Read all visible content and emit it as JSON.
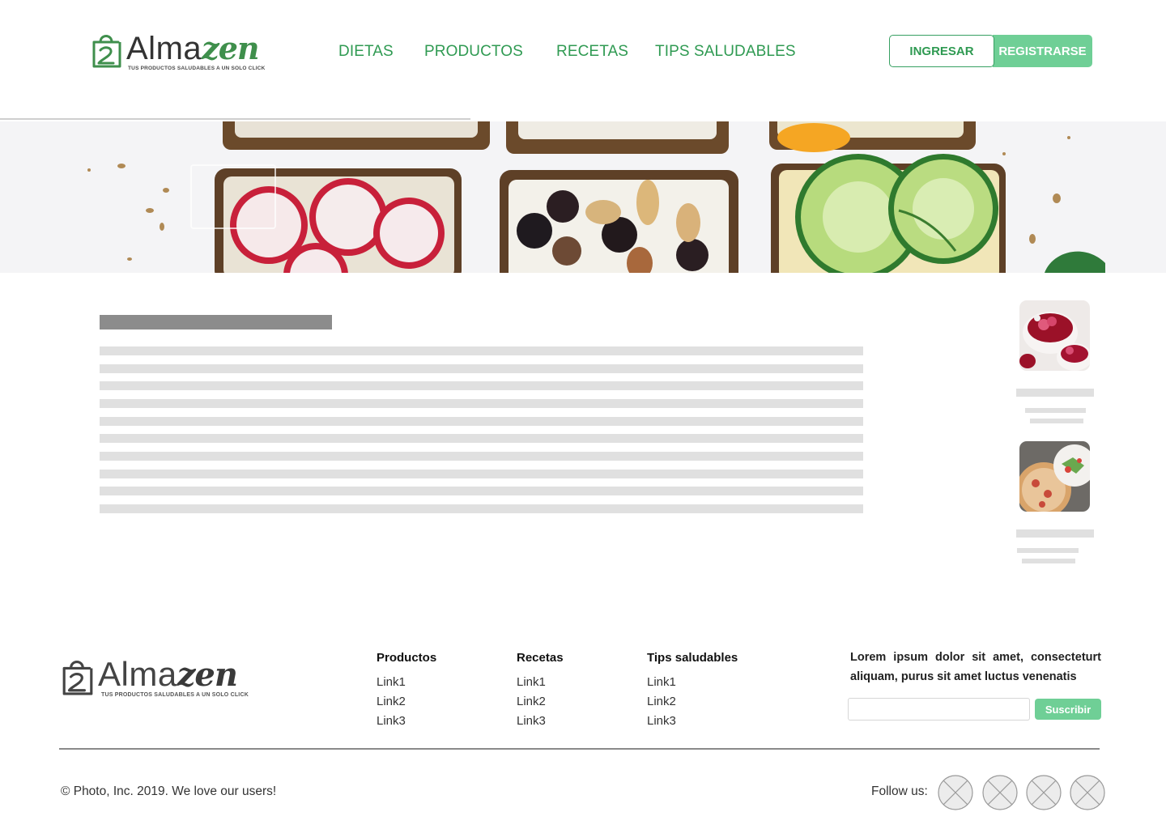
{
  "header": {
    "logo": {
      "alma": "Alma",
      "zen": "zen",
      "tagline": "TUS PRODUCTOS SALUDABLES A UN SOLO CLICK"
    },
    "nav": [
      {
        "label": "DIETAS"
      },
      {
        "label": "PRODUCTOS"
      },
      {
        "label": "RECETAS"
      },
      {
        "label": "TIPS SALUDABLES"
      }
    ],
    "login_label": "INGRESAR",
    "register_label": "REGISTRARSE"
  },
  "colors": {
    "brand_green": "#2f9a52",
    "button_green": "#6fcf96",
    "placeholder_gray": "#e0e0e0",
    "title_gray": "#8c8c8c"
  },
  "hero": {
    "image": "healthy open sandwiches with radish, cheese, nuts and cucumber"
  },
  "sidebar": {
    "thumbnails": [
      {
        "image": "raspberry-dessert-icon"
      },
      {
        "image": "pizza-salad-icon"
      }
    ]
  },
  "footer": {
    "logo": {
      "alma": "Alma",
      "zen": "zen",
      "tagline": "TUS PRODUCTOS SALUDABLES A UN SOLO CLICK"
    },
    "columns": [
      {
        "title": "Productos",
        "links": [
          "Link1",
          "Link2",
          "Link3"
        ]
      },
      {
        "title": "Recetas",
        "links": [
          "Link1",
          "Link2",
          "Link3"
        ]
      },
      {
        "title": "Tips saludables",
        "links": [
          "Link1",
          "Link2",
          "Link3"
        ]
      }
    ],
    "newsletter_text": "Lorem ipsum dolor sit amet, consecteturt aliquam, purus sit amet luctus venenatis",
    "newsletter_input_value": "",
    "subscribe_label": "Suscribir",
    "copyright": "© Photo, Inc. 2019. We love our users!",
    "follow_label": "Follow us:",
    "social_icons": [
      "social-placeholder-icon",
      "social-placeholder-icon",
      "social-placeholder-icon",
      "social-placeholder-icon"
    ]
  }
}
